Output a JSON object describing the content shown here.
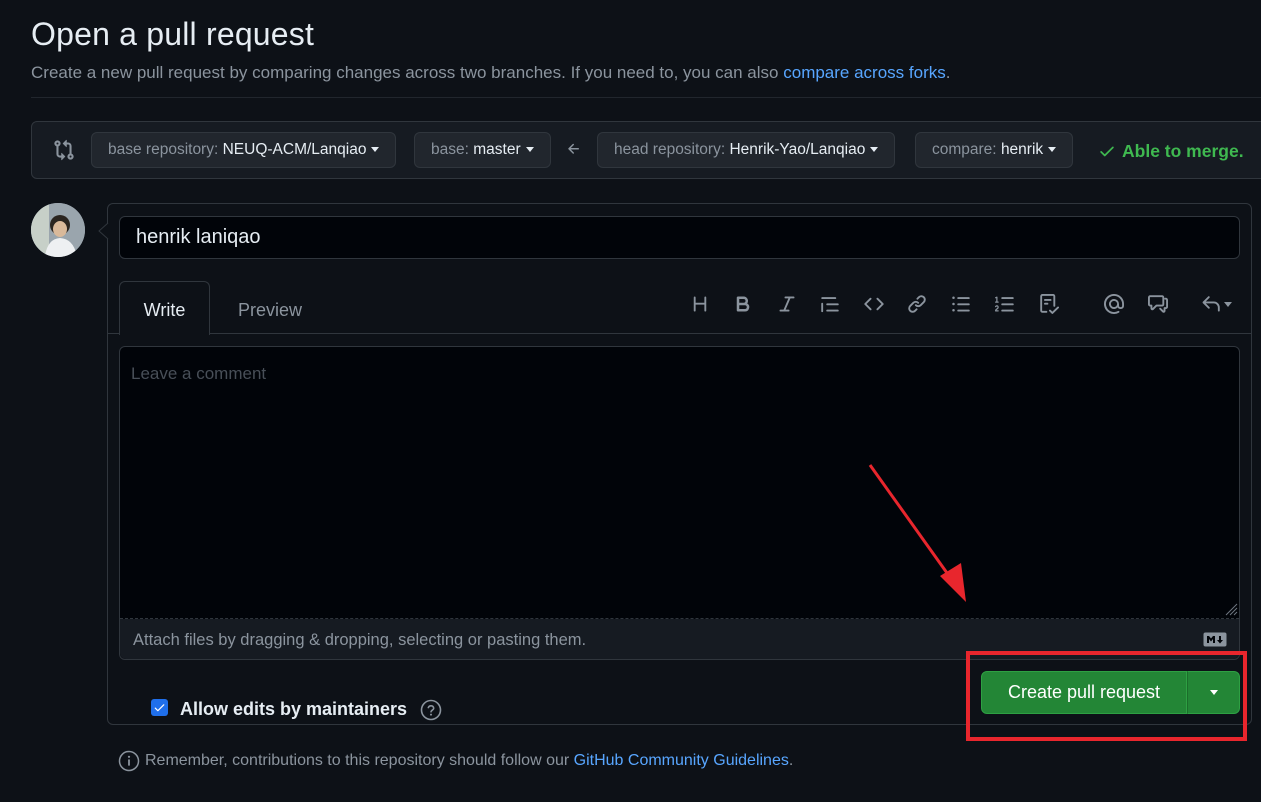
{
  "page": {
    "title": "Open a pull request",
    "subtitle_prefix": "Create a new pull request by comparing changes across two branches. If you need to, you can also",
    "subtitle_link": "compare across forks",
    "subtitle_suffix": "."
  },
  "range": {
    "base_repo_label": "base repository:",
    "base_repo_value": "NEUQ-ACM/Lanqiao",
    "base_label": "base:",
    "base_value": "master",
    "head_repo_label": "head repository:",
    "head_repo_value": "Henrik-Yao/Lanqiao",
    "compare_label": "compare:",
    "compare_value": "henrik",
    "merge_status": "Able to merge.",
    "merge_color": "#3fb950"
  },
  "form": {
    "title_value": "henrik laniqao",
    "tab_write": "Write",
    "tab_preview": "Preview",
    "toolbar_icons": [
      "heading-icon",
      "bold-icon",
      "italic-icon",
      "quote-icon",
      "code-icon",
      "link-icon",
      "bulleted-list-icon",
      "numbered-list-icon",
      "task-list-icon",
      "mention-icon",
      "cross-reference-icon",
      "reply-icon"
    ],
    "comment_placeholder": "Leave a comment",
    "attach_text": "Attach files by dragging & dropping, selecting or pasting them.",
    "allow_edits_label": "Allow edits by maintainers",
    "allow_edits_checked": true,
    "create_button": "Create pull request",
    "button_color": "#238636"
  },
  "footer": {
    "note_prefix": "Remember, contributions to this repository should follow our",
    "note_link": "GitHub Community Guidelines",
    "note_suffix": "."
  },
  "annotation": {
    "highlight_color": "#e8262d"
  }
}
